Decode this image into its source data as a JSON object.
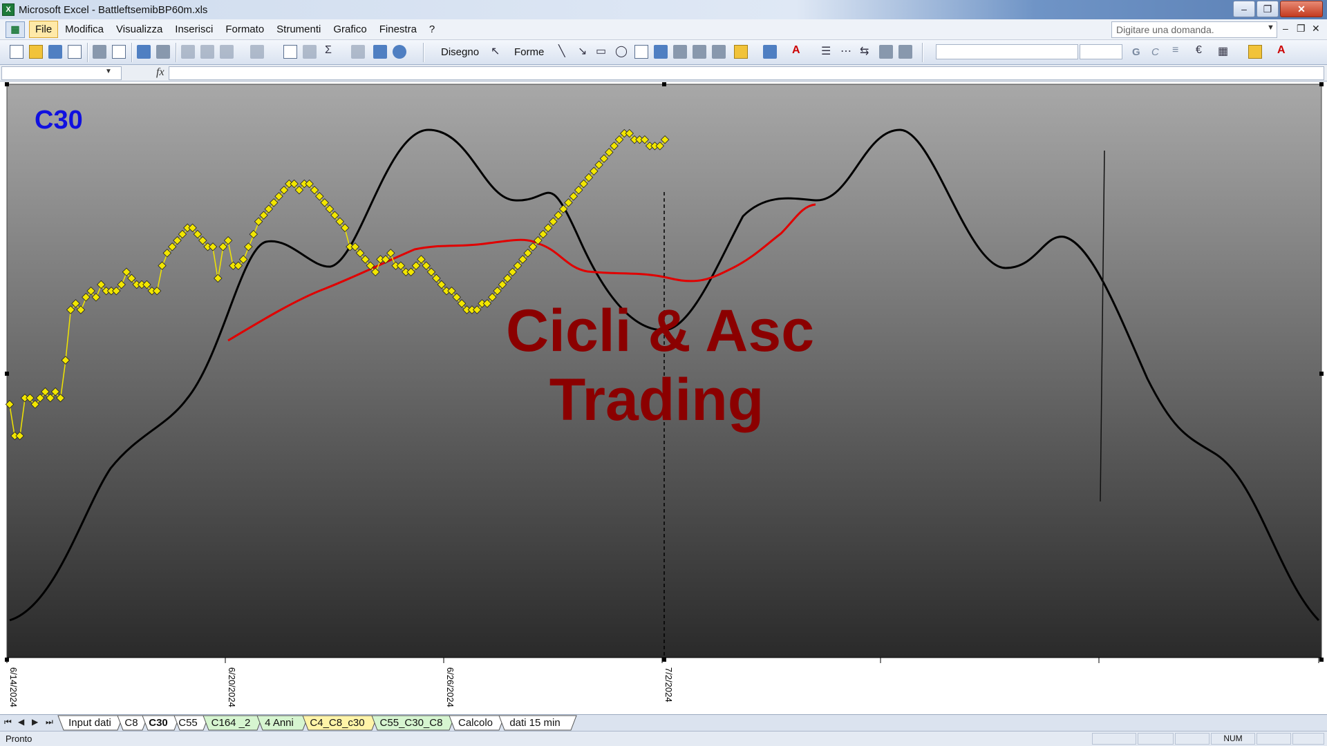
{
  "window": {
    "title": "Microsoft Excel - BattleftsemibBP60m.xls"
  },
  "menubar": {
    "items": [
      "File",
      "Modifica",
      "Visualizza",
      "Inserisci",
      "Formato",
      "Strumenti",
      "Grafico",
      "Finestra",
      "?"
    ],
    "active_item": "File",
    "ask_placeholder": "Digitare una domanda."
  },
  "toolbar": {
    "drawing_label": "Disegno",
    "shapes_label": "Forme",
    "bold_label": "G",
    "italic_label": "C"
  },
  "chart": {
    "label": "C30",
    "watermark_line1": "Cicli & Asc",
    "watermark_line2": "Trading",
    "x_tick_labels": [
      "6/14/2024",
      "6/20/2024",
      "6/26/2024",
      "7/2/2024"
    ],
    "colors": {
      "background_top": "#a8a8a8",
      "background_bottom": "#2a2a2a",
      "price": "#f2e600",
      "cycle": "#000000",
      "average": "#e00000",
      "label": "#1010e0",
      "watermark": "#8b0000"
    }
  },
  "chart_data": {
    "type": "line",
    "series": [
      {
        "name": "",
        "kind": "price",
        "values": [
          45,
          40,
          40,
          46,
          46,
          45,
          46,
          47,
          46,
          47,
          46,
          52,
          60,
          61,
          60,
          62,
          63,
          62,
          64,
          63,
          63,
          63,
          64,
          66,
          65,
          64,
          64,
          64,
          63,
          63,
          67,
          69,
          70,
          71,
          72,
          73,
          73,
          72,
          71,
          70,
          70,
          65,
          70,
          71,
          67,
          67,
          68,
          70,
          72,
          74,
          75,
          76,
          77,
          78,
          79,
          80,
          80,
          79,
          80,
          80,
          79,
          78,
          77,
          76,
          75,
          74,
          73,
          70,
          70,
          69,
          68,
          67,
          66,
          68,
          68,
          69,
          67,
          67,
          66,
          66,
          67,
          68,
          67,
          66,
          65,
          64,
          63,
          63,
          62,
          61,
          60,
          60,
          60,
          61,
          61,
          62,
          63,
          64,
          65,
          66,
          67,
          68,
          69,
          70,
          71,
          72,
          73,
          74,
          75,
          76,
          77,
          78,
          79,
          80,
          81,
          82,
          83,
          84,
          85,
          86,
          87,
          88,
          88,
          87,
          87,
          87,
          86,
          86,
          86,
          87
        ]
      }
    ]
  },
  "sheet_tabs": [
    "Input dati",
    "C8",
    "C30",
    "C55",
    "C164 _2",
    "4 Anni",
    "C4_C8_c30",
    "C55_C30_C8",
    "Calcolo",
    "dati 15 min"
  ],
  "active_sheet": "C30",
  "statusbar": {
    "text": "Pronto",
    "num": "NUM"
  }
}
